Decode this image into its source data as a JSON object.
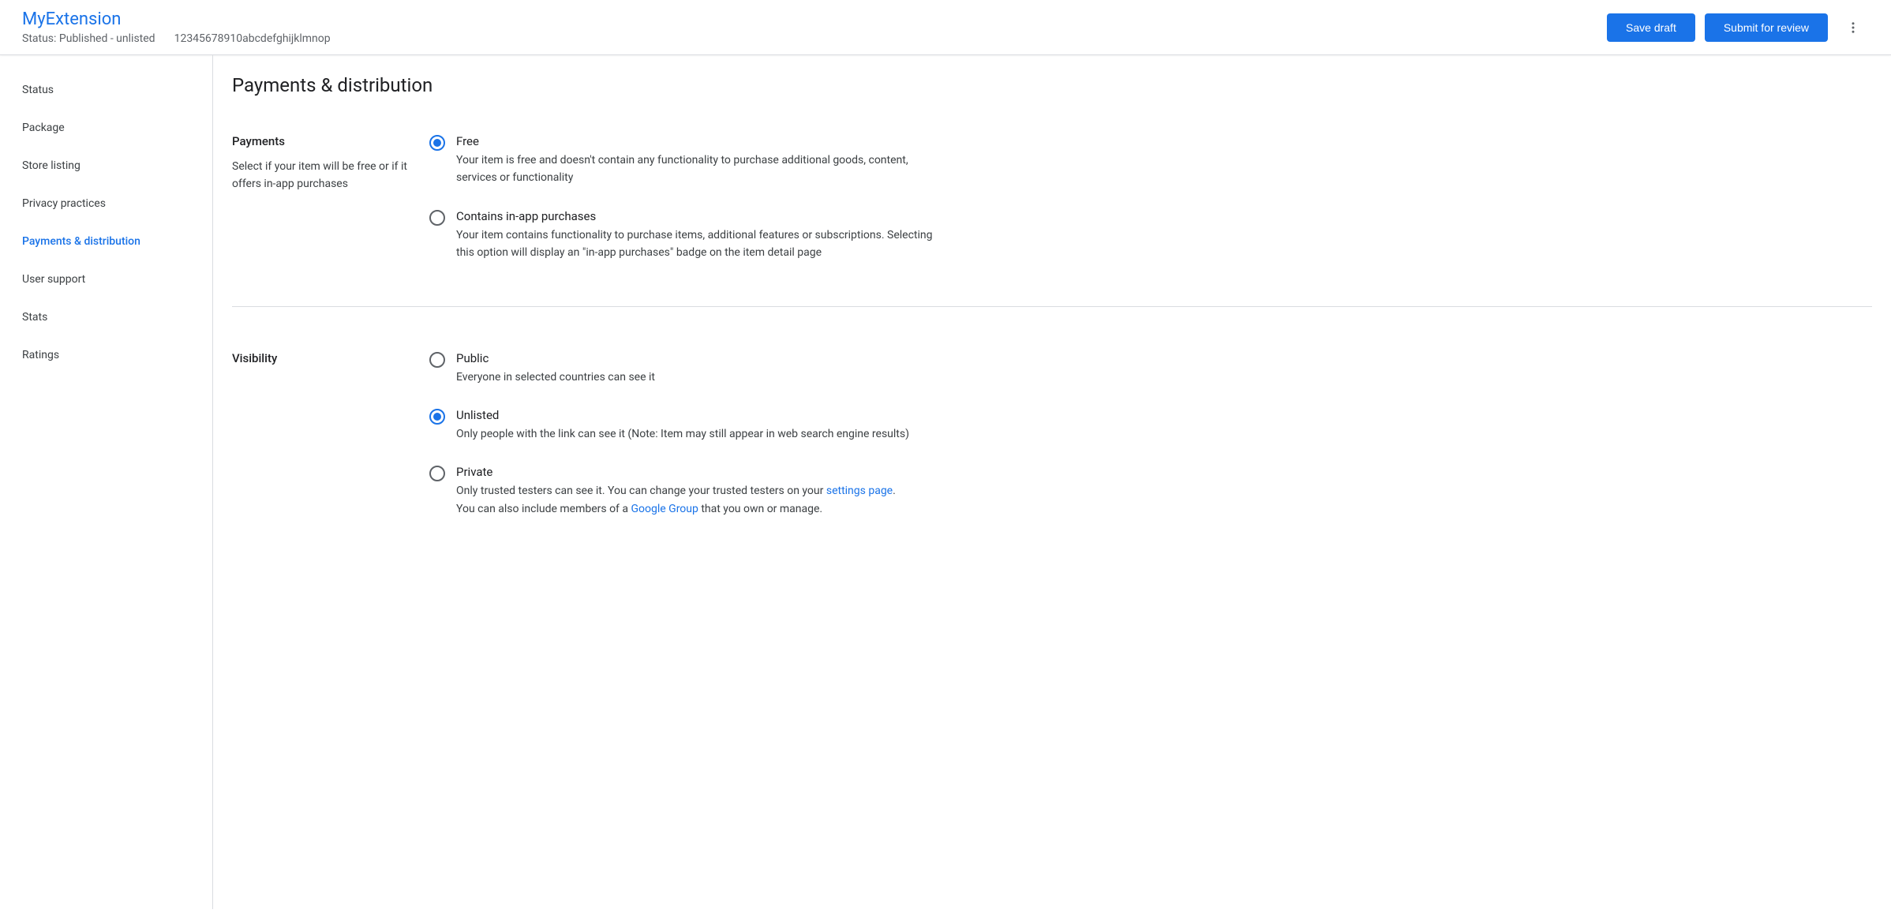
{
  "header": {
    "title": "MyExtension",
    "status": "Status: Published - unlisted",
    "item_id": "12345678910abcdefghijklmnop",
    "save_draft": "Save draft",
    "submit": "Submit for review"
  },
  "sidebar": {
    "items": [
      {
        "label": "Status",
        "active": false
      },
      {
        "label": "Package",
        "active": false
      },
      {
        "label": "Store listing",
        "active": false
      },
      {
        "label": "Privacy practices",
        "active": false
      },
      {
        "label": "Payments & distribution",
        "active": true
      },
      {
        "label": "User support",
        "active": false
      },
      {
        "label": "Stats",
        "active": false
      },
      {
        "label": "Ratings",
        "active": false
      }
    ]
  },
  "main": {
    "title": "Payments & distribution",
    "payments": {
      "label": "Payments",
      "desc": "Select if your item will be free or if it offers in-app purchases",
      "options": [
        {
          "title": "Free",
          "desc": "Your item is free and doesn't contain any functionality to purchase additional goods, content, services or functionality",
          "selected": true
        },
        {
          "title": "Contains in-app purchases",
          "desc": "Your item contains functionality to purchase items, additional features or subscriptions. Selecting this option will display an \"in-app purchases\" badge on the item detail page",
          "selected": false
        }
      ]
    },
    "visibility": {
      "label": "Visibility",
      "options": [
        {
          "title": "Public",
          "desc": "Everyone in selected countries can see it",
          "selected": false
        },
        {
          "title": "Unlisted",
          "desc": "Only people with the link can see it (Note: Item may still appear in web search engine results)",
          "selected": true
        },
        {
          "title": "Private",
          "desc_pre": "Only trusted testers can see it. You can change your trusted testers on your ",
          "link1": "settings page",
          "desc_mid": ".",
          "desc_line2_pre": "You can also include members of a ",
          "link2": "Google Group",
          "desc_line2_post": " that you own or manage.",
          "selected": false
        }
      ]
    }
  }
}
